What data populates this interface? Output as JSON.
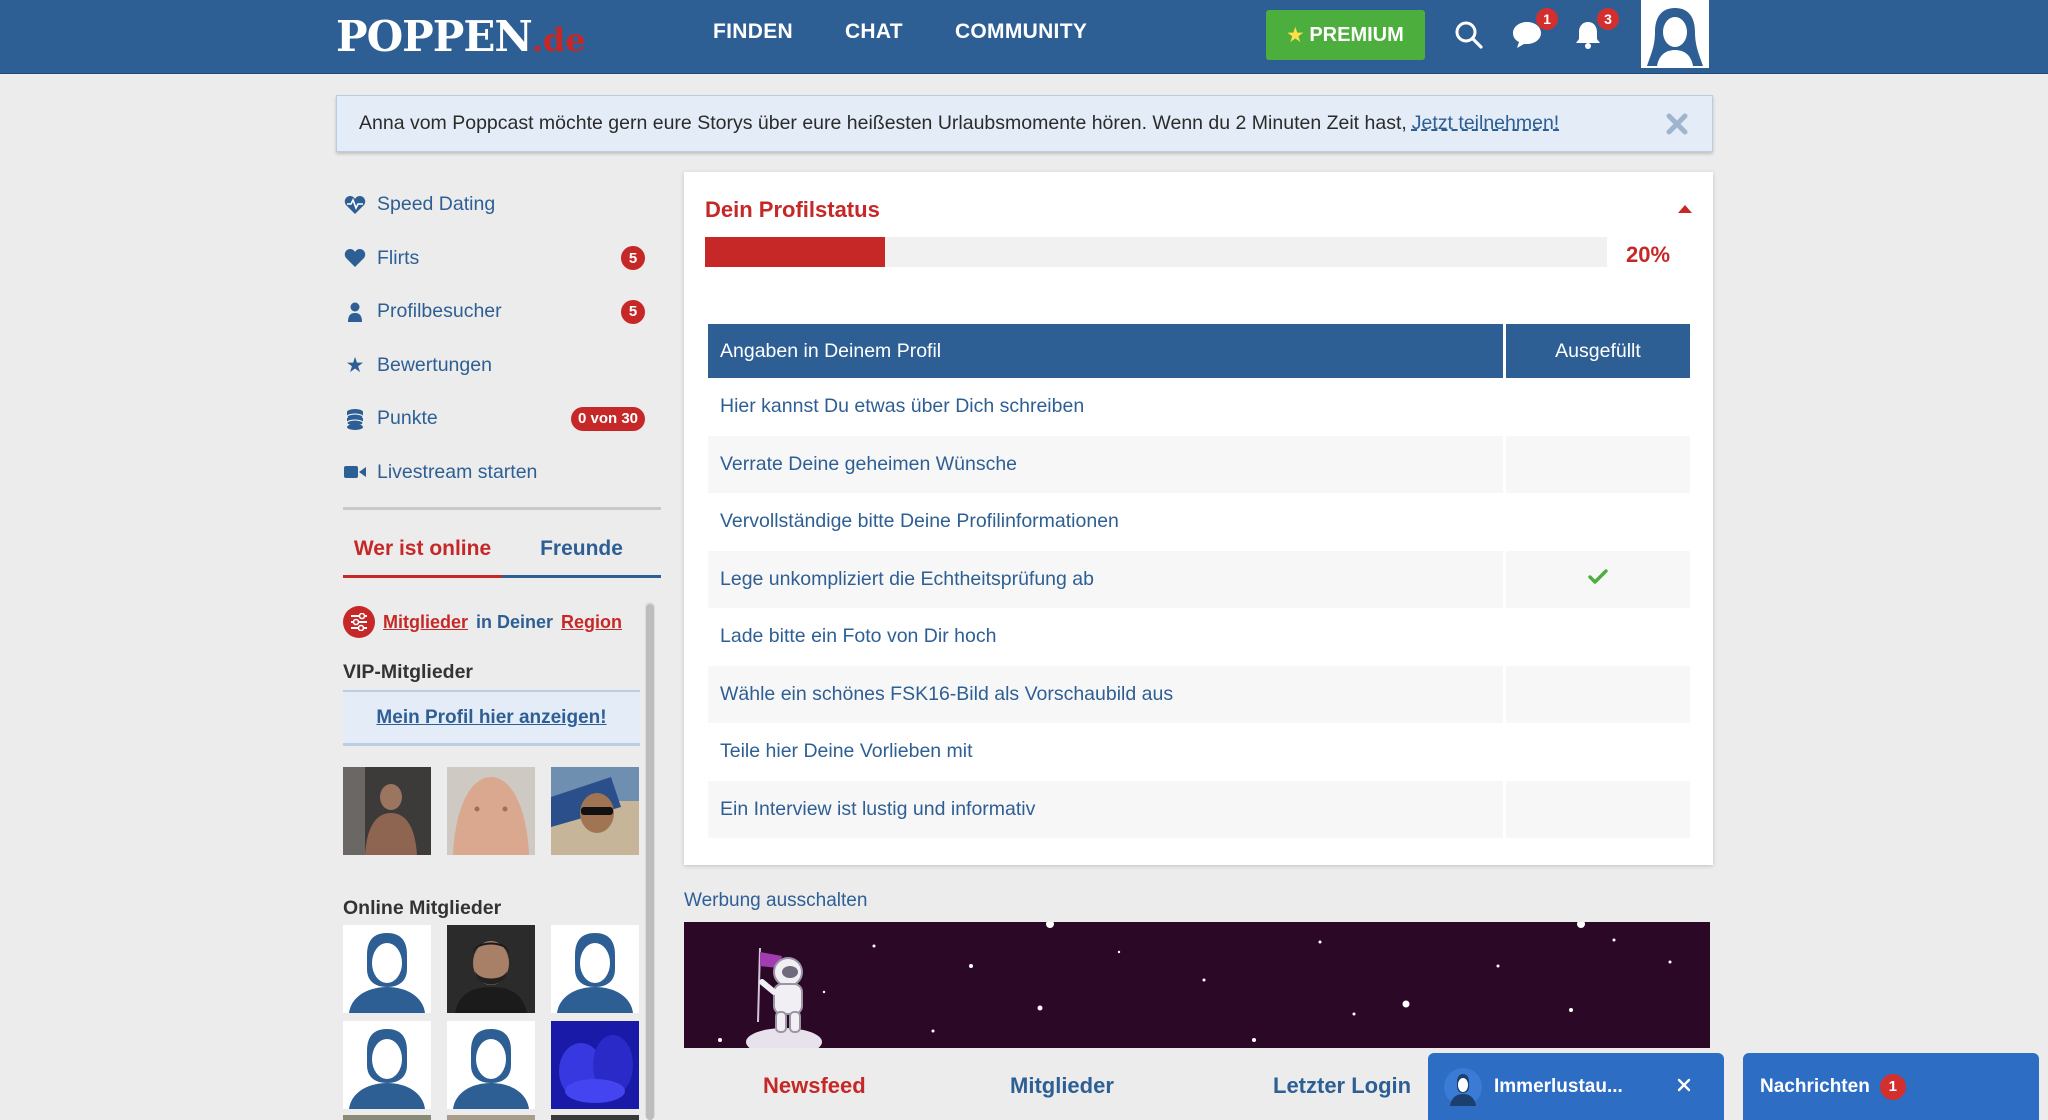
{
  "brand": {
    "logo_main": "POPPEN",
    "logo_tld": ".de"
  },
  "nav": {
    "items": [
      "FINDEN",
      "CHAT",
      "COMMUNITY"
    ]
  },
  "header": {
    "premium_label": "PREMIUM",
    "messages_badge": "1",
    "notifications_badge": "3"
  },
  "banner": {
    "text": "Anna vom Poppcast möchte gern eure Storys über eure heißesten Urlaubsmomente hören. Wenn du 2 Minuten Zeit hast,",
    "link": "Jetzt teilnehmen!"
  },
  "sidebar": {
    "items": [
      {
        "label": "Speed Dating",
        "icon": "heartbeat-icon",
        "badge": ""
      },
      {
        "label": "Flirts",
        "icon": "heart-icon",
        "badge": "5"
      },
      {
        "label": "Profilbesucher",
        "icon": "user-icon",
        "badge": "5"
      },
      {
        "label": "Bewertungen",
        "icon": "star-icon",
        "badge": ""
      },
      {
        "label": "Punkte",
        "icon": "coins-icon",
        "badge": "0 von 30"
      },
      {
        "label": "Livestream starten",
        "icon": "video-camera-icon",
        "badge": ""
      }
    ],
    "tabs": [
      "Wer ist online",
      "Freunde"
    ],
    "region": {
      "link1": "Mitglieder",
      "middle": "in Deiner",
      "link2": "Region"
    },
    "vip_title": "VIP-Mitglieder",
    "vip_link": "Mein Profil hier anzeigen!",
    "online_title": "Online Mitglieder"
  },
  "profile_status": {
    "title": "Dein Profilstatus",
    "progress": 0.2,
    "percent_label": "20%",
    "table": {
      "headers": [
        "Angaben in Deinem Profil",
        "Ausgefüllt"
      ],
      "rows": [
        {
          "label": "Hier kannst Du etwas über Dich schreiben",
          "done": false
        },
        {
          "label": "Verrate Deine geheimen Wünsche",
          "done": false
        },
        {
          "label": "Vervollständige bitte Deine Profilinformationen",
          "done": false
        },
        {
          "label": "Lege unkompliziert die Echtheitsprüfung ab",
          "done": true
        },
        {
          "label": "Lade bitte ein Foto von Dir hoch",
          "done": false
        },
        {
          "label": "Wähle ein schönes FSK16-Bild als Vorschaubild aus",
          "done": false
        },
        {
          "label": "Teile hier Deine Vorlieben mit",
          "done": false
        },
        {
          "label": "Ein Interview ist lustig und informativ",
          "done": false
        }
      ]
    }
  },
  "ad": {
    "remove_link": "Werbung ausschalten"
  },
  "bottom_tabs": [
    "Newsfeed",
    "Mitglieder",
    "Letzter Login"
  ],
  "chat": {
    "minimized_name": "Immerlustau...",
    "messages_label": "Nachrichten",
    "messages_count": "1"
  },
  "colors": {
    "header_blue": "#2e5f94",
    "accent_red": "#c62828",
    "premium_green": "#4cae3c",
    "chat_blue": "#2d6dc4"
  }
}
